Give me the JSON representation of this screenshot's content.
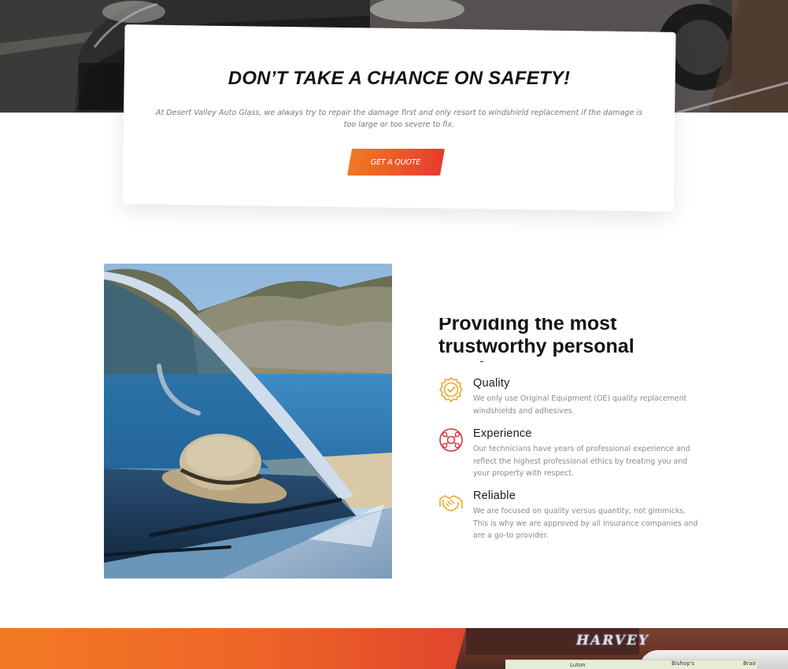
{
  "safety": {
    "title": "DON’T TAKE A CHANCE ON SAFETY!",
    "text": "At Desert Valley Auto Glass, we always try to repair the damage first and only resort to windshield replacement if the damage is too large or too severe to fix.",
    "button_label": "GET A QUOTE"
  },
  "service": {
    "heading_line1": "Providing the most",
    "heading_line2": "trustworthy personal service",
    "features": [
      {
        "icon": "quality-badge-icon",
        "title": "Quality",
        "desc": "We only use Original Equipment (OE) quality replacement windshields and adhesives."
      },
      {
        "icon": "experience-network-icon",
        "title": "Experience",
        "desc": "Our technicians have years of professional experience and reflect the highest professional ethics by treating you and your property with respect."
      },
      {
        "icon": "reliable-handshake-icon",
        "title": "Reliable",
        "desc": "We are focused on quality versus quantity, not gimmicks. This is why we are approved by all insurance companies and are a go-to provider."
      }
    ]
  },
  "footer": {
    "sign_text": "HARVEY",
    "map_labels": [
      "Luton",
      "Bishop's",
      "Brair"
    ]
  },
  "colors": {
    "accent_orange": "#f07a22",
    "accent_red": "#e83a30",
    "icon_gold": "#f0a62a",
    "icon_red": "#d9363e"
  }
}
